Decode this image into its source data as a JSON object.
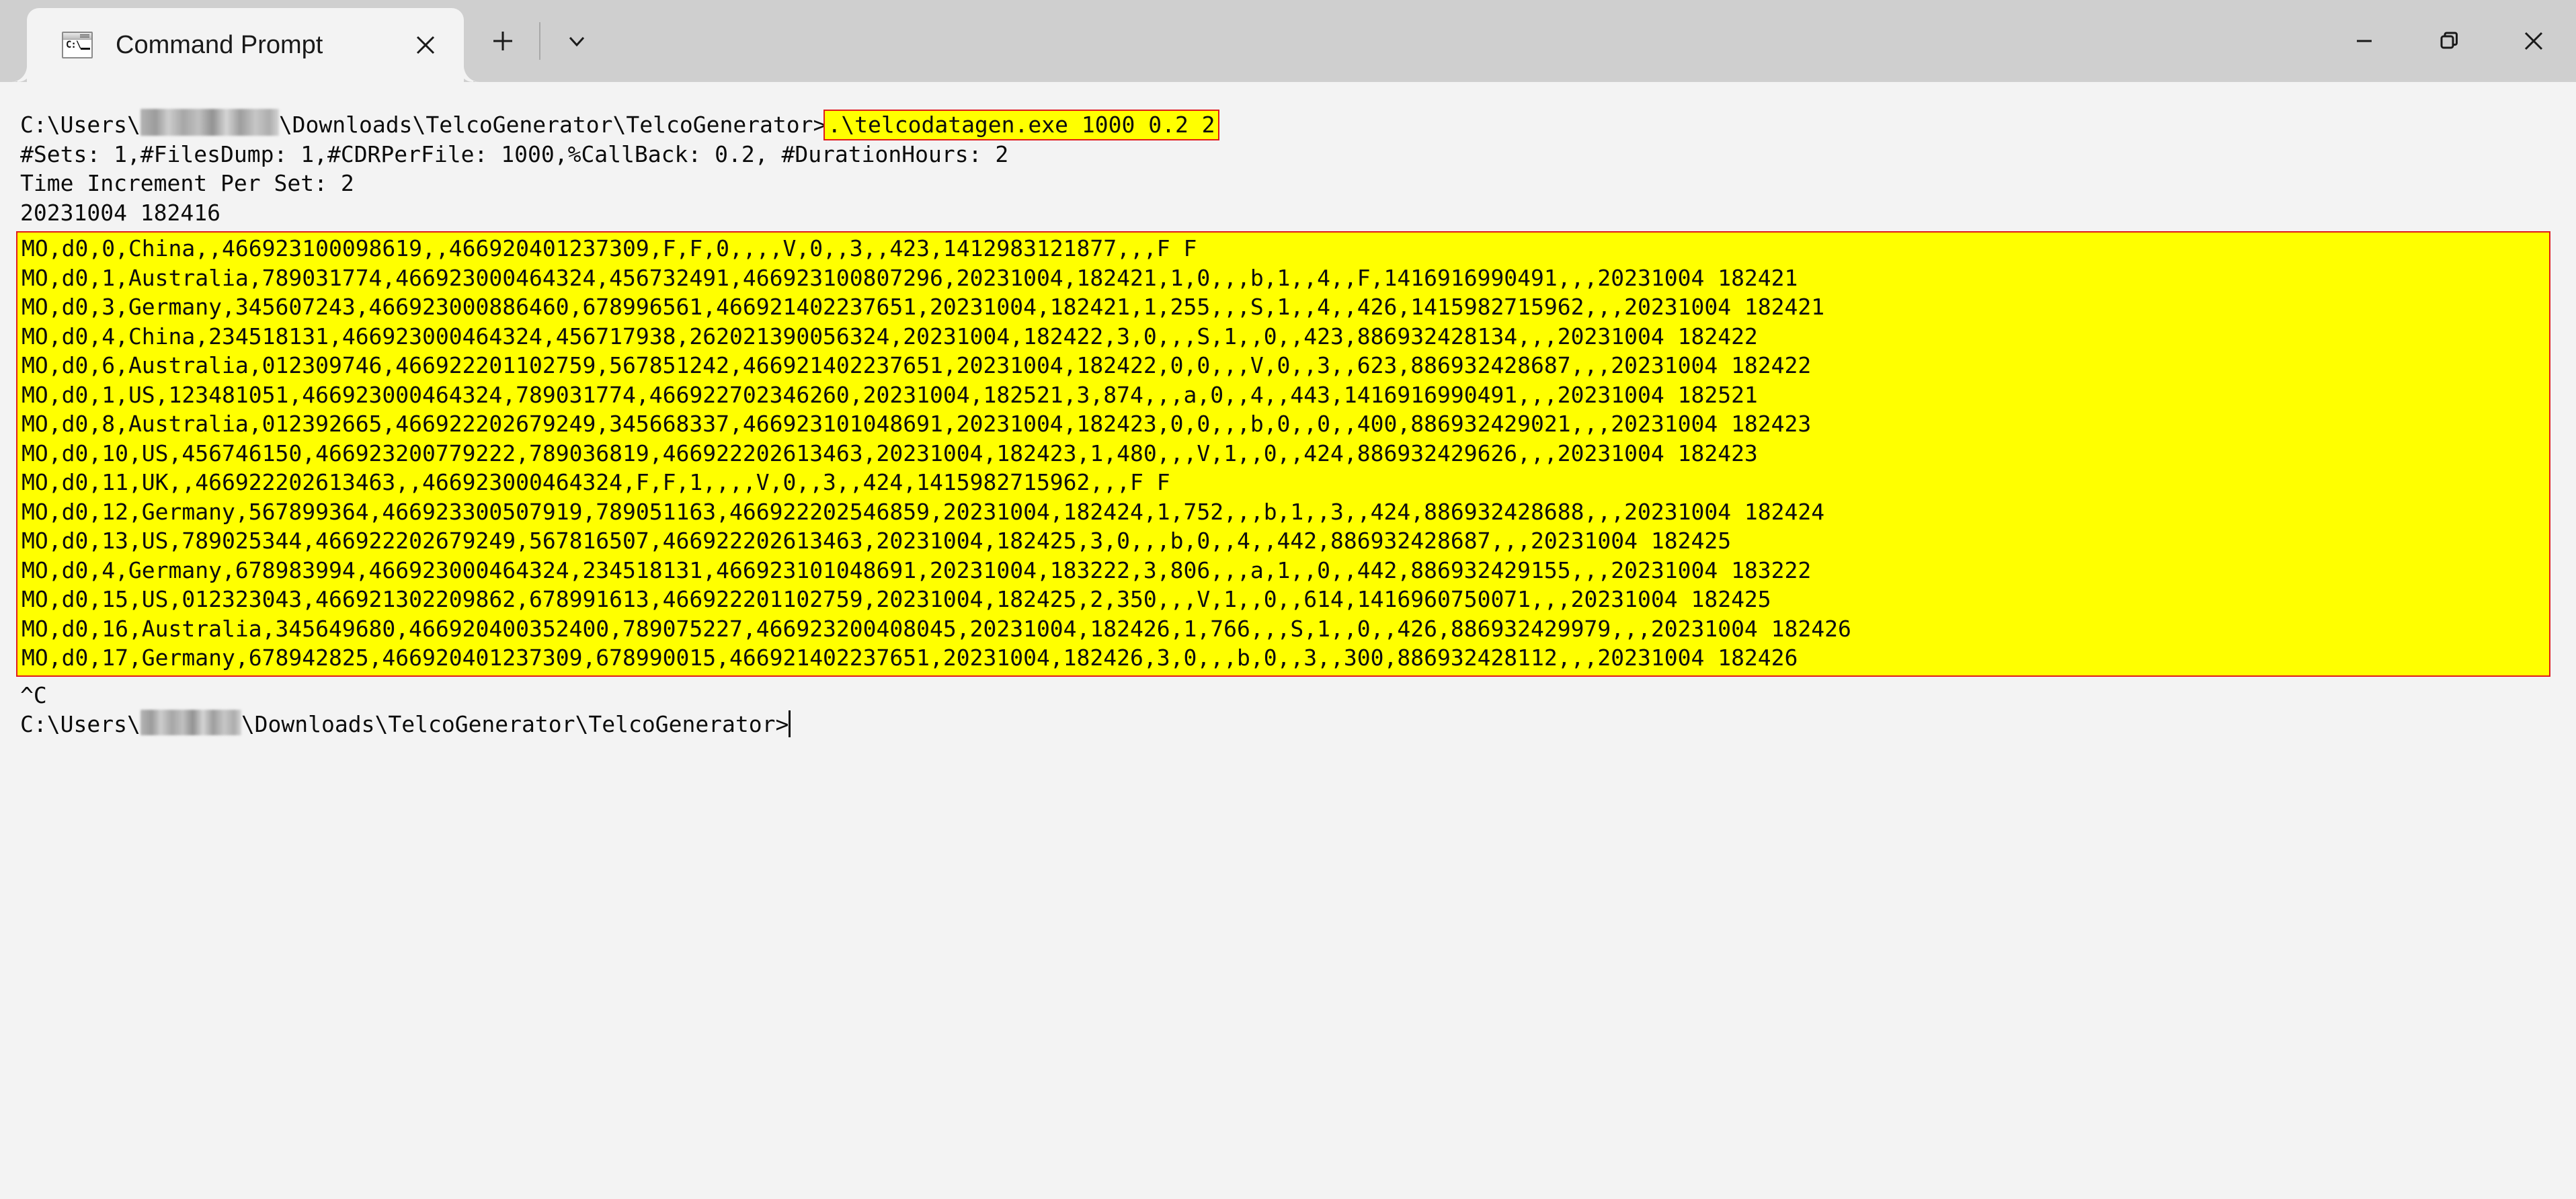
{
  "window": {
    "app_icon": "command-prompt-icon",
    "tab_title": "Command Prompt",
    "tab_close_label": "✕",
    "new_tab_label": "+",
    "dropdown_label": "⌄",
    "minimize_label": "—",
    "restore_label": "❐",
    "close_label": "✕",
    "colors": {
      "titlebar_bg": "#cfcfcf",
      "tab_bg": "#f3f3f3",
      "terminal_bg": "#f3f3f3",
      "terminal_fg": "#0c0c0c",
      "highlight_bg": "#ffff00",
      "highlight_border": "#e01b1b"
    }
  },
  "terminal": {
    "prompt_prefix": "C:\\Users\\",
    "prompt_suffix": "\\Downloads\\TelcoGenerator\\TelcoGenerator>",
    "redacted_username": "",
    "command": ".\\telcodatagen.exe 1000 0.2 2",
    "output_header": [
      "#Sets: 1,#FilesDump: 1,#CDRPerFile: 1000,%CallBack: 0.2, #DurationHours: 2",
      "Time Increment Per Set: 2",
      "20231004 182416"
    ],
    "cdr_lines": [
      "MO,d0,0,China,,466923100098619,,466920401237309,F,F,0,,,,V,0,,3,,423,1412983121877,,,F F",
      "MO,d0,1,Australia,789031774,466923000464324,456732491,466923100807296,20231004,182421,1,0,,,b,1,,4,,F,1416916990491,,,20231004 182421",
      "MO,d0,3,Germany,345607243,466923000886460,678996561,466921402237651,20231004,182421,1,255,,,S,1,,4,,426,1415982715962,,,20231004 182421",
      "MO,d0,4,China,234518131,466923000464324,456717938,262021390056324,20231004,182422,3,0,,,S,1,,0,,423,886932428134,,,20231004 182422",
      "MO,d0,6,Australia,012309746,466922201102759,567851242,466921402237651,20231004,182422,0,0,,,V,0,,3,,623,886932428687,,,20231004 182422",
      "MO,d0,1,US,123481051,466923000464324,789031774,466922702346260,20231004,182521,3,874,,,a,0,,4,,443,1416916990491,,,20231004 182521",
      "MO,d0,8,Australia,012392665,466922202679249,345668337,466923101048691,20231004,182423,0,0,,,b,0,,0,,400,886932429021,,,20231004 182423",
      "MO,d0,10,US,456746150,466923200779222,789036819,466922202613463,20231004,182423,1,480,,,V,1,,0,,424,886932429626,,,20231004 182423",
      "MO,d0,11,UK,,466922202613463,,466923000464324,F,F,1,,,,V,0,,3,,424,1415982715962,,,F F",
      "MO,d0,12,Germany,567899364,466923300507919,789051163,466922202546859,20231004,182424,1,752,,,b,1,,3,,424,886932428688,,,20231004 182424",
      "MO,d0,13,US,789025344,466922202679249,567816507,466922202613463,20231004,182425,3,0,,,b,0,,4,,442,886932428687,,,20231004 182425",
      "MO,d0,4,Germany,678983994,466923000464324,234518131,466923101048691,20231004,183222,3,806,,,a,1,,0,,442,886932429155,,,20231004 183222",
      "MO,d0,15,US,012323043,466921302209862,678991613,466922201102759,20231004,182425,2,350,,,V,1,,0,,614,1416960750071,,,20231004 182425",
      "MO,d0,16,Australia,345649680,466920400352400,789075227,466923200408045,20231004,182426,1,766,,,S,1,,0,,426,886932429979,,,20231004 182426",
      "MO,d0,17,Germany,678942825,466920401237309,678990015,466921402237651,20231004,182426,3,0,,,b,0,,3,,300,886932428112,,,20231004 182426"
    ],
    "interrupt": "^C"
  }
}
